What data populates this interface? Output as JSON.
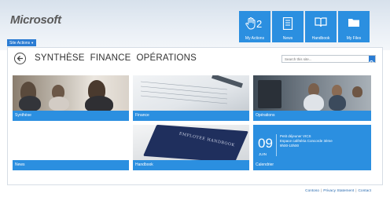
{
  "header": {
    "logo": "Microsoft",
    "site_actions": "Site Actions",
    "tiles": [
      {
        "label": "My Actions",
        "icon": "hand-icon",
        "count": "2"
      },
      {
        "label": "News",
        "icon": "document-icon"
      },
      {
        "label": "Handbook",
        "icon": "book-icon"
      },
      {
        "label": "My Files",
        "icon": "folder-icon"
      }
    ]
  },
  "nav": {
    "items": [
      "SYNTHÈSE",
      "FINANCE",
      "OPÉRATIONS"
    ]
  },
  "search": {
    "placeholder": "Search this site..."
  },
  "grid": {
    "synthese": "Synthèse",
    "finance": "Finance",
    "operations": "Opérations",
    "news": "News",
    "handbook": "Handbook",
    "calendar": "Calendrier",
    "handbook_cover": "EMPLOYEE HANDBOOK"
  },
  "calendar": {
    "day": "09",
    "month": "JUIN",
    "event_title": "Petit déjeuner VICS",
    "event_location": "Espace cafétéria Concorde 3ème",
    "event_time": "9h00-10h00"
  },
  "footer": {
    "links": [
      "Contoso",
      "Privacy Statement",
      "Contact"
    ]
  },
  "colors": {
    "accent": "#2b8fe0",
    "accent_dark": "#2b7cd3"
  }
}
